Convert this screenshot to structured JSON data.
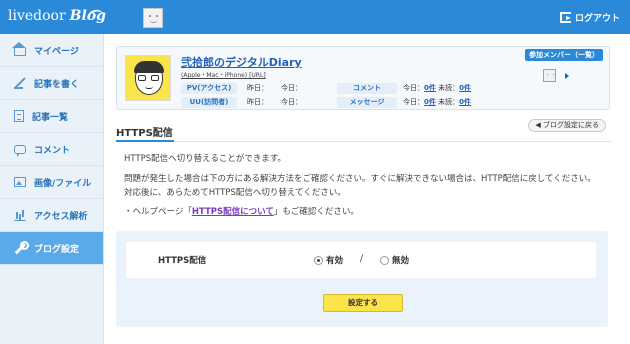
{
  "header": {
    "logo_text": "livedoor",
    "logo_blog": "Blog",
    "logout_label": "ログアウト"
  },
  "sidebar": {
    "items": [
      {
        "label": "マイページ",
        "icon": "home-icon"
      },
      {
        "label": "記事を書く",
        "icon": "pen-icon"
      },
      {
        "label": "記事一覧",
        "icon": "document-icon"
      },
      {
        "label": "コメント",
        "icon": "comment-icon"
      },
      {
        "label": "画像/ファイル",
        "icon": "image-icon"
      },
      {
        "label": "アクセス解析",
        "icon": "chart-icon"
      },
      {
        "label": "ブログ設定",
        "icon": "wrench-icon"
      }
    ],
    "active_index": 6
  },
  "profile": {
    "title": "弐拾郎のデジタルDiary",
    "subtitle": "(Apple・Mac・iPhone) [URL]",
    "pv_label": "PV(アクセス)",
    "uu_label": "UU(訪問者)",
    "yesterday": "昨日：",
    "today": "今日：",
    "comment_label": "コメント",
    "message_label": "メッセージ",
    "comment_today": "今日：",
    "comment_today_val": "0件",
    "comment_unread": "未読：",
    "comment_unread_val": "0件",
    "message_today": "今日：",
    "message_today_val": "0件",
    "message_unread": "未読：",
    "message_unread_val": "0件",
    "members_button": "参加メンバー（一覧）"
  },
  "section": {
    "title": "HTTPS配信",
    "back_button": "◀ ブログ設定に戻る"
  },
  "content": {
    "line1": "HTTPS配信へ切り替えることができます。",
    "line2": "問題が発生した場合は下の方にある解決方法をご確認ください。すぐに解決できない場合は、HTTP配信に戻してください。対応後に、あらためてHTTPS配信へ切り替えてください。",
    "help_prefix": "・ヘルプページ「",
    "help_link": "HTTPS配信について",
    "help_suffix": "」もご確認ください。"
  },
  "form": {
    "label": "HTTPS配信",
    "option_on": "有効",
    "option_off": "無効",
    "separator": "/",
    "selected": "有効",
    "submit_label": "設定する"
  },
  "colors": {
    "header_bg": "#2a8ad9",
    "sidebar_active": "#5aaae8",
    "submit_bg": "#fbe44a"
  }
}
